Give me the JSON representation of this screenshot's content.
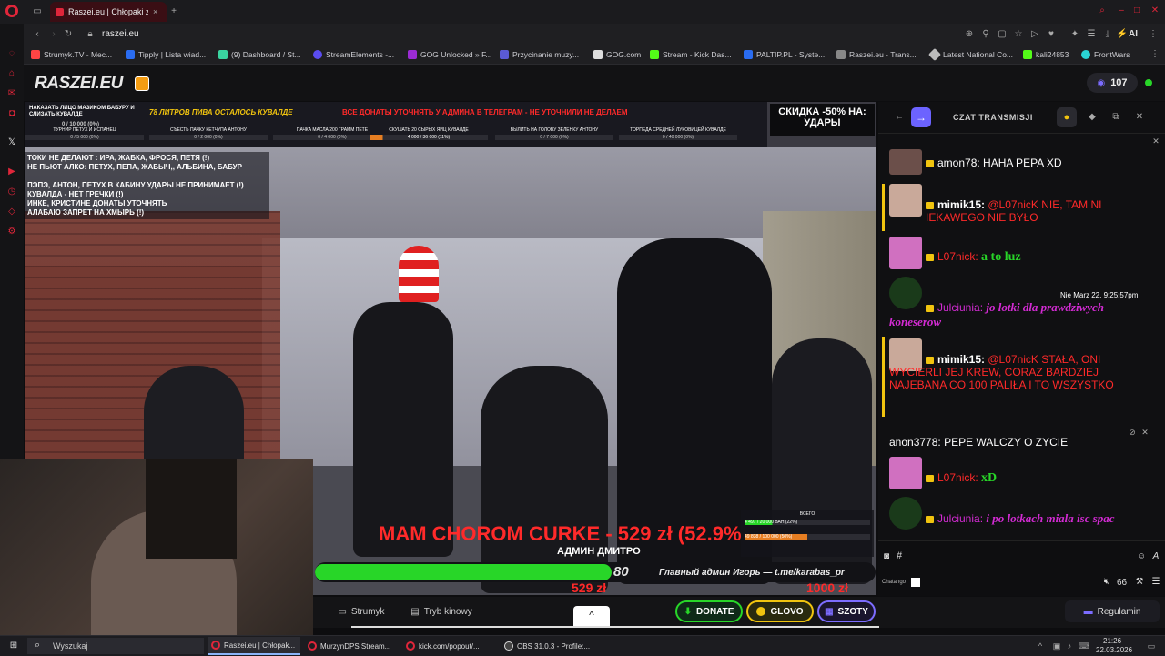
{
  "browser": {
    "active_tab_title": "Raszei.eu | Chłopaki z",
    "address": "raszei.eu",
    "bookmarks": [
      "Strumyk.TV - Mec...",
      "Tipply | Lista wiad...",
      "(9) Dashboard / St...",
      "StreamElements -...",
      "GOG Unlocked » F...",
      "Przycinanie muzy...",
      "GOG.com",
      "Stream - Kick Das...",
      "PALTIP.PL - Syste...",
      "Raszei.eu - Trans...",
      "Latest National Co...",
      "kali24853",
      "FrontWars"
    ],
    "ai_label": "AI"
  },
  "site": {
    "logo": "RASZEI.EU",
    "viewers": "107"
  },
  "overlay": {
    "beer_text": "78 ЛИТРОВ ПИВА ОСТАЛОСЬ КУВАЛДЕ",
    "donations_text": "ВСЕ ДОНАТЫ УТОЧНЯТЬ У АДМИНА В ТЕЛЕГРАМ - НЕ УТОЧНИЛИ НЕ ДЕЛАЕМ",
    "discount_line1": "СКИДКА -50% НА:",
    "discount_line2": "УДАРЫ",
    "goal1": "НАКАЗАТЬ ЛИЦО МАЗИКОМ БАБУРУ И СЛИЗАТЬ КУВАЛДЕ",
    "goal1_val": "0 / 10 000 (0%)",
    "goals": [
      {
        "label": "ТУРНИР ПЕТУХ И ИСПАНЕЦ",
        "val": "0 / 5 000 (0%)"
      },
      {
        "label": "СЪЕСТЬ ПАЧКУ КЕТЧУПА АНТОНУ",
        "val": "0 / 2 000 (0%)"
      },
      {
        "label": "ПАЧКА МАСЛА 200 ГРАММ ПЕТЕ",
        "val": "0 / 4 000 (0%)"
      },
      {
        "label": "СКУШАТЬ 20 СЫРЫХ ЯИЦ КУВАЛДЕ",
        "val": "4 000 / 36 000 (11%)"
      },
      {
        "label": "ВЫЛИТЬ НА ГОЛОВУ ЗЕЛЕНКУ АНТОНУ",
        "val": "0 / 7 000 (0%)"
      },
      {
        "label": "ТОРПЕДА СРЕДНЕЙ ЛУКОВИЦЕЙ КУВАЛДЕ",
        "val": "0 / 40 000 (0%)"
      }
    ],
    "rules": [
      "ТОКИ НЕ ДЕЛАЮТ : ИРА, ЖАБКА, ФРОСЯ, ПЕТЯ (!)",
      "НЕ ПЬЮТ АЛКО: ПЕТУХ, ПЕПА, ЖАБЫЧ,, АЛЬБИНА, БАБУР",
      "",
      "ПЭПЭ, АНТОН, ПЕТУХ В КАБИНУ УДАРЫ НЕ ПРИНИМАЕТ (!)",
      " КУВАЛДА - НЕТ ГРЕЧКИ (!)",
      "ИНКЕ, КРИСТИНЕ ДОНАТЫ УТОЧНЯТЬ",
      "АЛАБАЮ ЗАПРЕТ НА ХМЫРЬ (!)"
    ],
    "donation_alert": "MAM CHOROM CURKE - 529 zł (52.9%",
    "admin_name": "АДМИН ДМИТРО",
    "bar_left_value": "529 zł",
    "bar_right_value": "1000 zł",
    "bar_mid_value": "80",
    "ticker": "Главный админ Игорь — t.me/karabas_pr",
    "total_label": "ВСЕГО",
    "total_val1": "4 497 / 20 000 ВАН (22%)",
    "total_val2": "49 838 / 100 000 (50%)",
    "donation_progress": 0.529
  },
  "chat": {
    "title": "CZAT TRANSMISJI",
    "messages": [
      {
        "user": "amon78:",
        "text": "HAHA PEPA XD"
      },
      {
        "user": "mimik15:",
        "text": "@L07nicK NIE, TAM NI IEKAWEGO NIE BYŁO"
      },
      {
        "user": "L07nick:",
        "text": "a to luz"
      },
      {
        "user": "Julciunia:",
        "text": "jo lotki dla prawdziwych koneserow",
        "time": "Nie Marz 22, 9:25:57pm"
      },
      {
        "user": "mimik15:",
        "text": "@L07nicK STAŁA, ONI WYCIERLI JEJ KREW, CORAZ BARDZIEJ NAJEBANA CO 100 PALIŁA I TO WSZYSTKO"
      },
      {
        "user": "anon3778:",
        "text": "PEPE WALCZY O ZYCIE"
      },
      {
        "user": "L07nick:",
        "text": "xD"
      },
      {
        "user": "Julciunia:",
        "text": "i po lotkach miala isc spac"
      }
    ],
    "hash": "#",
    "chatango": "Chatango",
    "count": "66"
  },
  "bottom": {
    "strumyk": "Strumyk",
    "tryb": "Tryb kinowy",
    "donate": "DONATE",
    "glovo": "GLOVO",
    "szoty": "SZOTY",
    "regulamin": "Regulamin"
  },
  "taskbar": {
    "search": "Wyszukaj",
    "apps": [
      "Raszei.eu | Chłopak...",
      "MurzynDPS Stream...",
      "kick.com/popout/...",
      "OBS 31.0.3 - Profile:..."
    ],
    "time": "21:26",
    "date": "22.03.2026"
  },
  "colors": {
    "red": "#ff2a2a",
    "green": "#28d628",
    "magenta": "#d42bd4",
    "accent": "#6c63ff"
  }
}
